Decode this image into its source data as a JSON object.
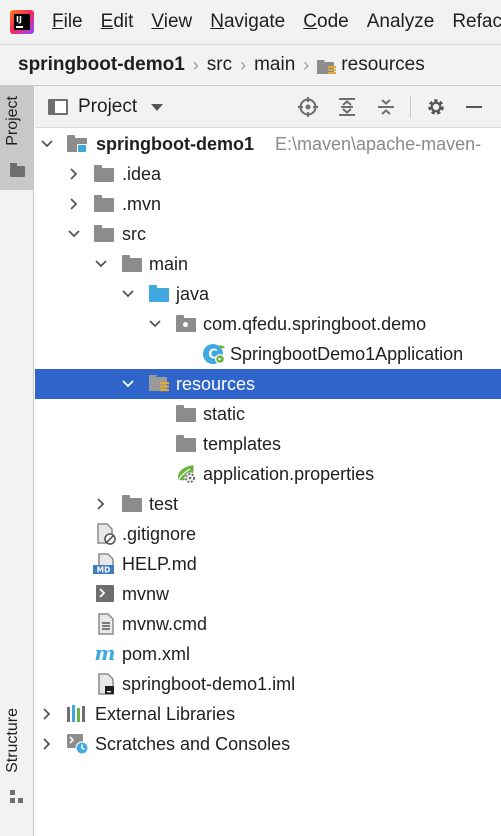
{
  "menubar": {
    "items": [
      {
        "label": "File",
        "mnemonic": "F",
        "rest": "ile"
      },
      {
        "label": "Edit",
        "mnemonic": "E",
        "rest": "dit"
      },
      {
        "label": "View",
        "mnemonic": "V",
        "rest": "iew"
      },
      {
        "label": "Navigate",
        "mnemonic": "N",
        "rest": "avigate"
      },
      {
        "label": "Code",
        "mnemonic": "C",
        "rest": "ode"
      },
      {
        "label": "Analyze",
        "mnemonic": "",
        "rest": "Analyze"
      },
      {
        "label": "Refactor",
        "mnemonic": "",
        "rest": "Refac"
      }
    ]
  },
  "breadcrumb": {
    "project": "springboot-demo1",
    "items": [
      "src",
      "main",
      "resources"
    ]
  },
  "toolstrip": {
    "project_tab": "Project",
    "structure_tab": "Structure"
  },
  "panel": {
    "title": "Project"
  },
  "tree": {
    "root_label": "springboot-demo1",
    "root_path": "E:\\maven\\apache-maven-",
    "idea": ".idea",
    "mvn": ".mvn",
    "src": "src",
    "main": "main",
    "java": "java",
    "package": "com.qfedu.springboot.demo",
    "app_class": "SpringbootDemo1Application",
    "resources": "resources",
    "static": "static",
    "templates": "templates",
    "app_properties": "application.properties",
    "test": "test",
    "gitignore": ".gitignore",
    "help": "HELP.md",
    "mvnw": "mvnw",
    "mvnw_cmd": "mvnw.cmd",
    "pom": "pom.xml",
    "iml": "springboot-demo1.iml",
    "external_libs": "External Libraries",
    "scratches": "Scratches and Consoles"
  },
  "colors": {
    "selection": "#2f65ca",
    "folder_gray": "#8c8c8c",
    "folder_blue": "#40a8df",
    "spring_green": "#6db33f"
  }
}
